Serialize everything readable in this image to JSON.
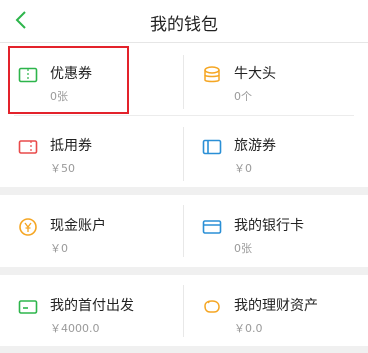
{
  "header": {
    "title": "我的钱包",
    "back_icon": "chevron-left-icon"
  },
  "colors": {
    "accent_green": "#2db54b",
    "accent_orange": "#f5a623",
    "accent_red": "#e94a4a",
    "accent_blue": "#2a8fd6",
    "highlight_red": "#e3222b"
  },
  "wallet": {
    "coupon": {
      "label": "优惠券",
      "value": "0张",
      "icon": "ticket-icon"
    },
    "niu": {
      "label": "牛大头",
      "value": "0个",
      "icon": "coin-stack-icon"
    },
    "voucher": {
      "label": "抵用券",
      "value": "￥50",
      "icon": "voucher-icon"
    },
    "travel": {
      "label": "旅游券",
      "value": "￥0",
      "icon": "travel-ticket-icon"
    },
    "cash": {
      "label": "现金账户",
      "value": "￥0",
      "icon": "yen-coin-icon"
    },
    "bank": {
      "label": "我的银行卡",
      "value": "0张",
      "icon": "bank-card-icon"
    },
    "first_pay": {
      "label": "我的首付出发",
      "value": "￥4000.0",
      "icon": "wallet-card-icon"
    },
    "assets": {
      "label": "我的理财资产",
      "value": "￥0.0",
      "icon": "piggy-bank-icon"
    }
  }
}
